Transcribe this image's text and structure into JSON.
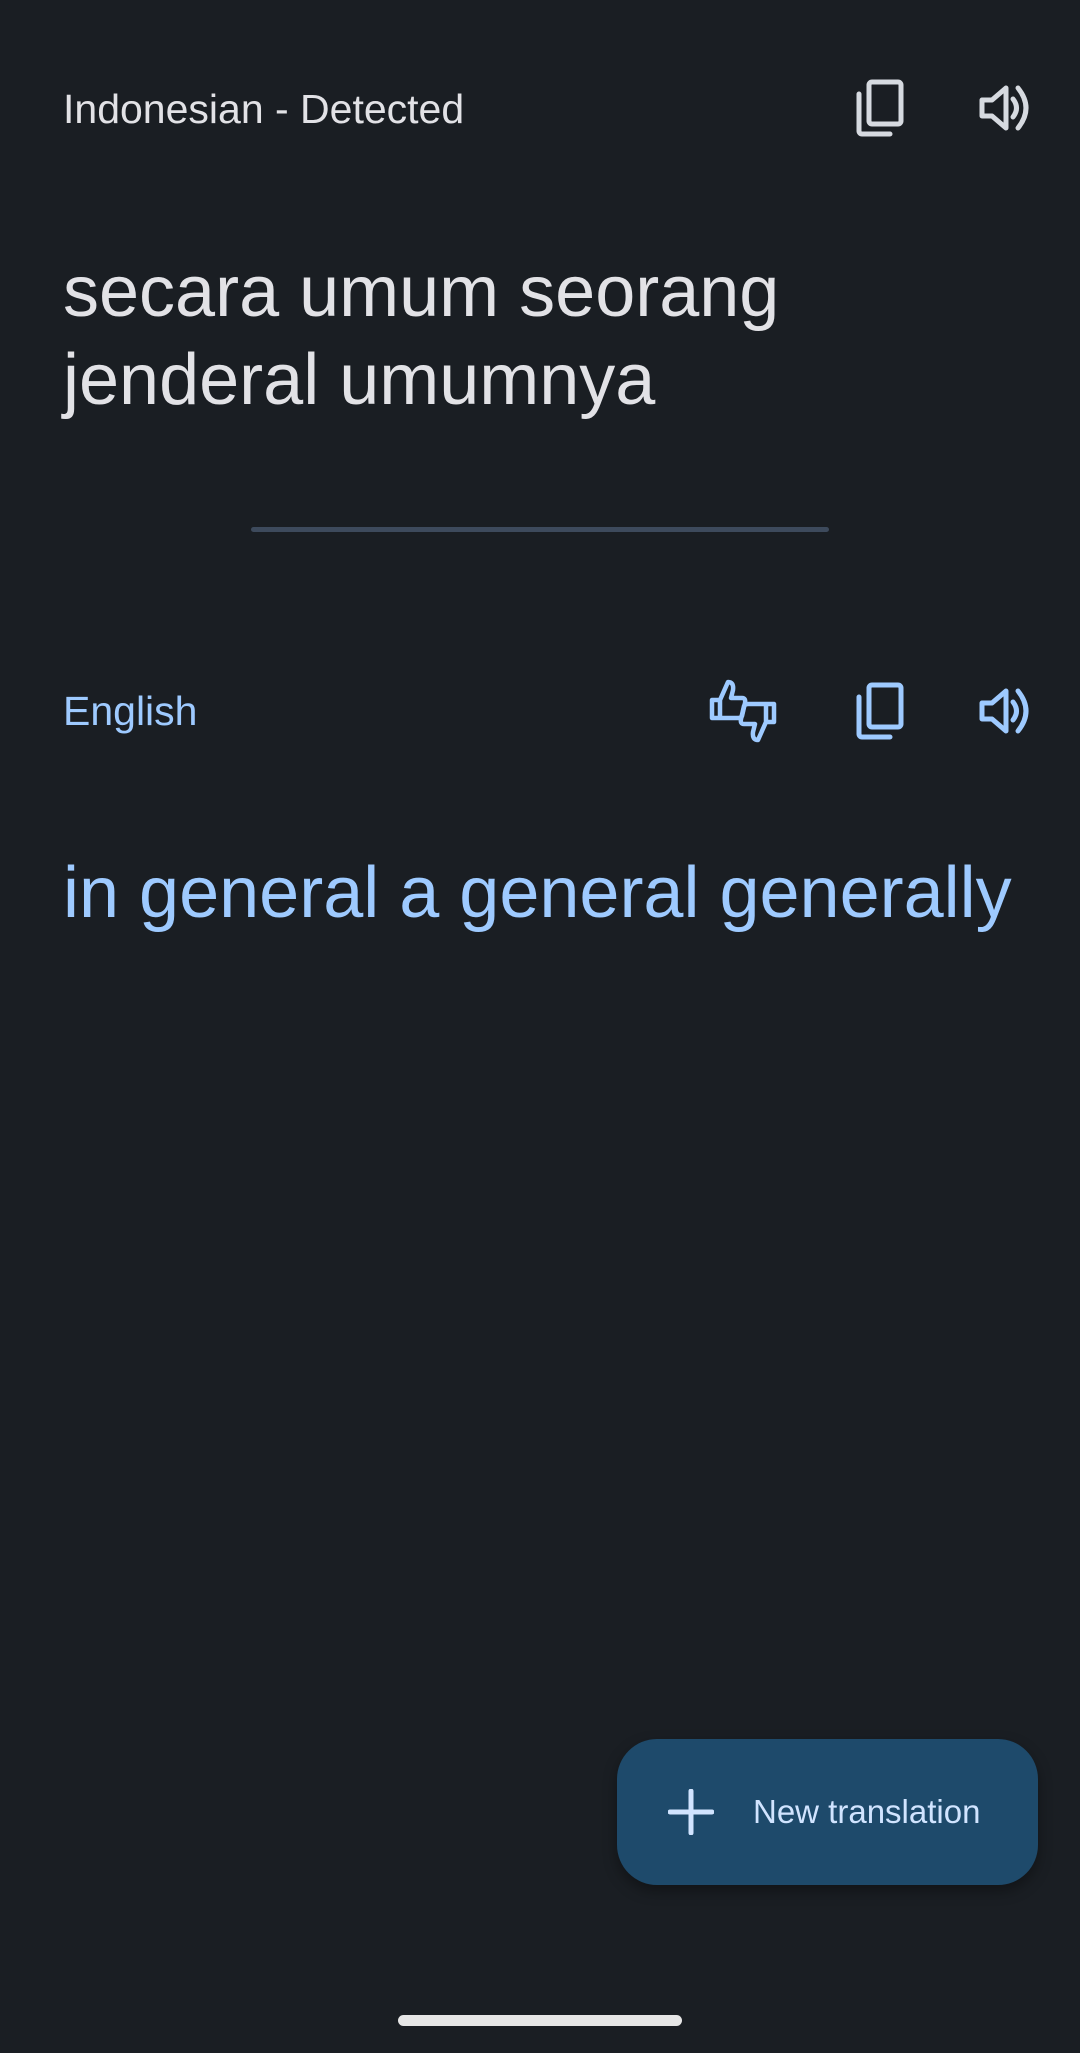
{
  "source": {
    "language_label": "Indonesian - Detected",
    "text": "secara umum seorang jenderal umumnya",
    "icons": {
      "copy": "copy-icon",
      "speak": "volume-icon"
    }
  },
  "target": {
    "language_label": "English",
    "text": "in general a general generally",
    "icons": {
      "rate": "thumbs-up-down-icon",
      "copy": "copy-icon",
      "speak": "volume-icon"
    }
  },
  "fab": {
    "label": "New translation",
    "icon": "plus-icon"
  },
  "colors": {
    "background": "#1a1e23",
    "source_text": "#e2e2e6",
    "target_accent": "#9ecaff",
    "fab_background": "#1e4a6b",
    "divider": "#3d4a5c"
  }
}
